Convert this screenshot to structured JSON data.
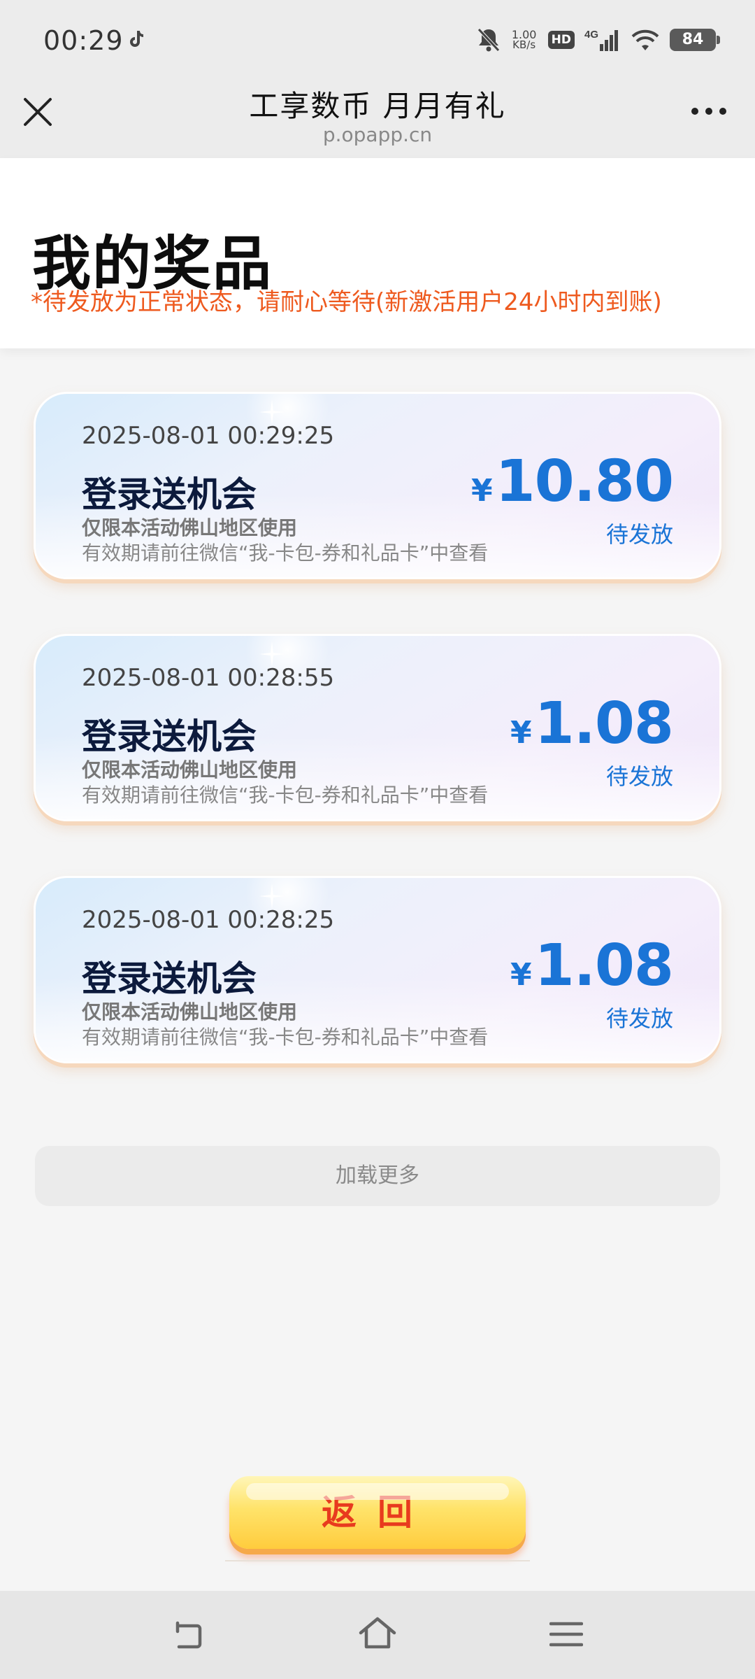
{
  "status_bar": {
    "time": "00:29",
    "speed_value": "1.00",
    "speed_unit": "KB/s",
    "hd_label": "HD",
    "network_label": "4G",
    "battery": "84",
    "icons": [
      "tiktok-icon",
      "mute-icon",
      "signal-icon",
      "wifi-icon",
      "battery-icon"
    ]
  },
  "title_bar": {
    "title": "工享数币  月月有礼",
    "domain": "p.opapp.cn",
    "icons": [
      "close-icon",
      "more-icon"
    ]
  },
  "header": {
    "title": "我的奖品",
    "notice": "*待发放为正常状态，请耐心等待(新激活用户24小时内到账)"
  },
  "prizes": [
    {
      "date": "2025-08-01 00:29:25",
      "name": "登录送机会",
      "scope": "仅限本活动佛山地区使用",
      "validity": "有效期请前往微信“我-卡包-券和礼品卡”中查看",
      "currency": "¥",
      "amount": "10.80",
      "status": "待发放"
    },
    {
      "date": "2025-08-01 00:28:55",
      "name": "登录送机会",
      "scope": "仅限本活动佛山地区使用",
      "validity": "有效期请前往微信“我-卡包-券和礼品卡”中查看",
      "currency": "¥",
      "amount": "1.08",
      "status": "待发放"
    },
    {
      "date": "2025-08-01 00:28:25",
      "name": "登录送机会",
      "scope": "仅限本活动佛山地区使用",
      "validity": "有效期请前往微信“我-卡包-券和礼品卡”中查看",
      "currency": "¥",
      "amount": "1.08",
      "status": "待发放"
    }
  ],
  "load_more": "加载更多",
  "back_button": "返回",
  "nav_bar": {
    "icons": [
      "nav-back-icon",
      "nav-home-icon",
      "nav-menu-icon"
    ]
  },
  "colors": {
    "accent_blue": "#1a74d6",
    "notice_orange": "#ee5a1f",
    "button_yellow": "#ffe36a",
    "button_text_red": "#e83b1e"
  }
}
